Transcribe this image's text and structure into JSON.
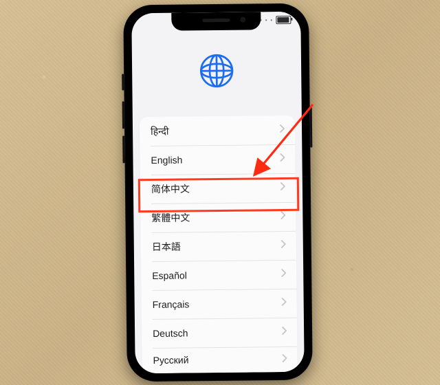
{
  "status": {
    "dots": "• • • •"
  },
  "icon": {
    "name": "globe-icon",
    "color": "#1d6df0"
  },
  "languages": [
    {
      "label": "हिन्दी"
    },
    {
      "label": "English"
    },
    {
      "label": "简体中文"
    },
    {
      "label": "繁體中文"
    },
    {
      "label": "日本語"
    },
    {
      "label": "Español"
    },
    {
      "label": "Français"
    },
    {
      "label": "Deutsch"
    },
    {
      "label": "Русский"
    }
  ],
  "annotation": {
    "highlight_index": 1,
    "highlight_color": "#ff3b1f",
    "arrow_color": "#ff2a12"
  }
}
